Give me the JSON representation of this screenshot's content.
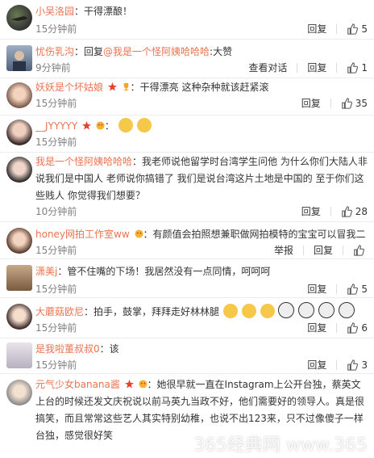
{
  "colors": {
    "name": "#eb7350",
    "time": "#808080",
    "text": "#333333"
  },
  "actions": {
    "reply": "回复",
    "report": "举报",
    "view_conversation": "查看对话"
  },
  "comments": [
    {
      "name": "小吴洛园",
      "text": "：干得漂酿！",
      "time": "15分钟前",
      "likes": "5"
    },
    {
      "name": "忧伤乳沟",
      "text_prefix": "：回复",
      "reply_to": "@我是一个怪阿姨哈哈哈",
      "text": ":大赞",
      "time": "9分钟前",
      "likes": "1"
    },
    {
      "name": "妖妖是个坏姑娘",
      "text": "：干得漂亮 这种杂种就该赶紧滚",
      "time": "15分钟前",
      "likes": "35"
    },
    {
      "name": "__JYYYYY",
      "text": "：",
      "time": "15分钟前",
      "likes": ""
    },
    {
      "name": "我是一个怪阿姨哈哈哈",
      "text": "：我老师说他留学时台湾学生问他 为什么你们大陆人非说我们是中国人 老师说你搞错了 我们是说台湾这片土地是中国的 至于你们这些贱人 你觉得我们想要？",
      "time": "10分钟前",
      "likes": "28"
    },
    {
      "name": "honey网拍工作室ww",
      "text": "：有颜值会拍照想兼职做网拍模特的宝宝可以冒我二",
      "time": "15分钟前",
      "likes": ""
    },
    {
      "name": "潇美j",
      "text": "：管不住嘴的下场！我居然没有一点同情，呵呵呵",
      "time": "15分钟前",
      "likes": "5"
    },
    {
      "name": "大蘑菇欧尼",
      "text": "：拍手，鼓掌，拜拜走好林林腿",
      "time": "15分钟前",
      "likes": "6"
    },
    {
      "name": "是我啦董叔叔0",
      "text": "：该",
      "time": "15分钟前",
      "likes": "3"
    },
    {
      "name": "元气少女banana酱",
      "text": "：她很早就一直在Instagram上公开台独，蔡英文上台的时候还发文庆祝说以前马英九当政不好，他们需要好的领导人。真是很搞笑，而且常常这些艺人其实特别幼稚，也说不出123来，只不过像傻子一样台独，感觉很好笑",
      "time": "",
      "likes": ""
    }
  ],
  "watermark": "365经典网 www.365"
}
